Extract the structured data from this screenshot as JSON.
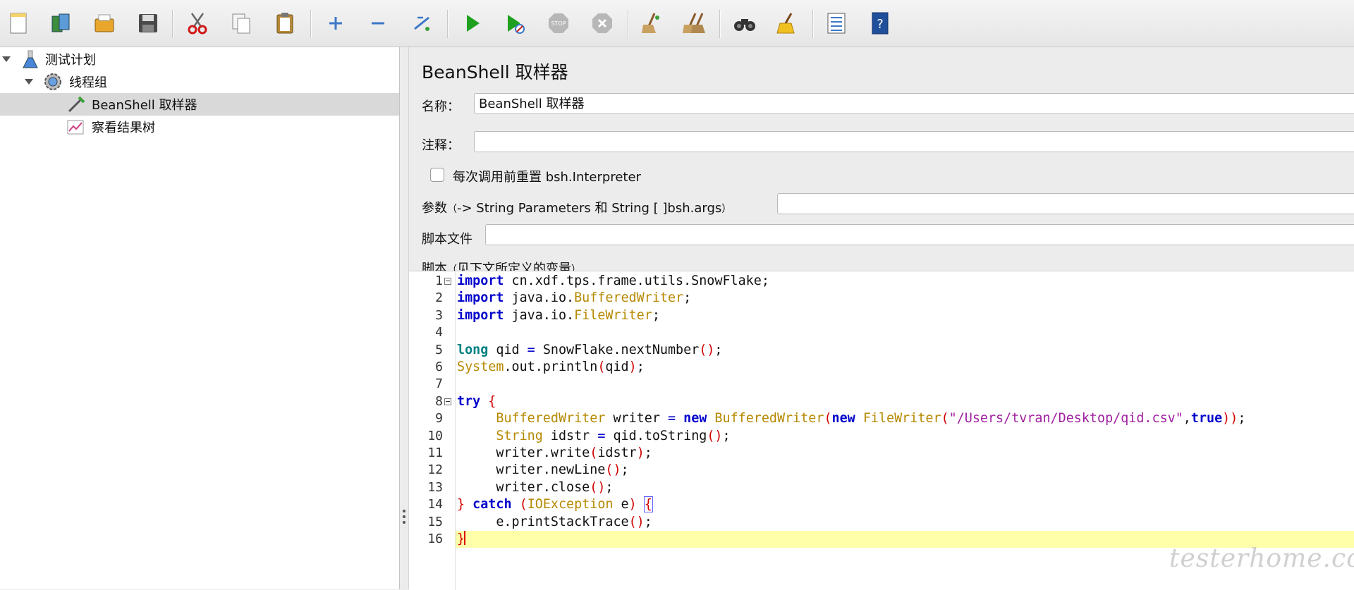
{
  "toolbar": {
    "buttons": [
      {
        "name": "new-icon",
        "tooltip": ""
      },
      {
        "name": "templates-icon"
      },
      {
        "name": "open-icon"
      },
      {
        "name": "save-icon"
      },
      {
        "name": "cut-icon"
      },
      {
        "name": "copy-icon"
      },
      {
        "name": "paste-icon"
      },
      {
        "name": "expand-icon"
      },
      {
        "name": "collapse-icon"
      },
      {
        "name": "toggle-icon"
      },
      {
        "name": "start-icon"
      },
      {
        "name": "start-no-pause-icon"
      },
      {
        "name": "stop-icon"
      },
      {
        "name": "shutdown-icon"
      },
      {
        "name": "clear-icon"
      },
      {
        "name": "clear-all-icon"
      },
      {
        "name": "search-icon"
      },
      {
        "name": "reset-search-icon"
      },
      {
        "name": "function-helper-icon"
      },
      {
        "name": "help-icon"
      }
    ]
  },
  "tree": {
    "items": [
      {
        "label": "测试计划",
        "icon": "test-plan-icon",
        "expanded": true
      },
      {
        "label": "线程组",
        "icon": "thread-group-icon",
        "expanded": true
      },
      {
        "label": "BeanShell 取样器",
        "icon": "sampler-icon",
        "selected": true
      },
      {
        "label": "察看结果树",
        "icon": "results-tree-icon"
      }
    ]
  },
  "panel": {
    "title": "BeanShell 取样器",
    "name_label": "名称：",
    "name_value": "BeanShell 取样器",
    "comment_label": "注释：",
    "comment_value": "",
    "reset_checkbox_label": "每次调用前重置 bsh.Interpreter",
    "reset_checked": false,
    "params_label_main": "参数",
    "params_label_detail": "-> String Parameters 和 String [ ]bsh.args",
    "params_value": "",
    "script_file_label": "脚本文件",
    "script_file_value": "",
    "script_label_main": "脚本",
    "script_label_detail": "见下文所定义的变量"
  },
  "editor": {
    "current_line": 16,
    "lines": [
      "import cn.xdf.tps.frame.utils.SnowFlake;",
      "import java.io.BufferedWriter;",
      "import java.io.FileWriter;",
      "",
      "long qid = SnowFlake.nextNumber();",
      "System.out.println(qid);",
      "",
      "try {",
      "     BufferedWriter writer = new BufferedWriter(new FileWriter(\"/Users/tvran/Desktop/qid.csv\",true));",
      "     String idstr = qid.toString();",
      "     writer.write(idstr);",
      "     writer.newLine();",
      "     writer.close();",
      "} catch (IOException e) {",
      "     e.printStackTrace();",
      "}"
    ]
  },
  "watermark": "testerhome.com",
  "colors": {
    "keyword": "#0000cc",
    "keyword_teal": "#008080",
    "type": "#b58900",
    "paren": "#d00000",
    "string": "#a020a0",
    "current_line": "#ffffaa"
  }
}
